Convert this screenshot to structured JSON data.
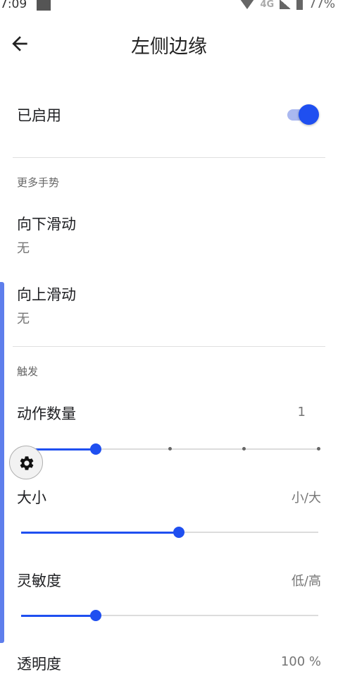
{
  "status": {
    "time": "7:09",
    "network": "4G",
    "battery": "77%"
  },
  "appbar": {
    "title": "左侧边缘",
    "back_icon": "arrow-left-icon"
  },
  "enabled": {
    "label": "已启用",
    "on": true
  },
  "sections": {
    "more_gestures": "更多手势",
    "trigger": "触发"
  },
  "swipe_down": {
    "label": "向下滑动",
    "value": "无"
  },
  "swipe_up": {
    "label": "向上滑动",
    "value": "无"
  },
  "action_count": {
    "label": "动作数量",
    "value": "1",
    "level": 0.25,
    "ticks": 5
  },
  "size": {
    "label": "大小",
    "value": "小/大",
    "level": 0.53
  },
  "sensitivity": {
    "label": "灵敏度",
    "value": "低/高",
    "level": 0.25
  },
  "opacity": {
    "label": "透明度",
    "value": "100 %"
  },
  "colors": {
    "accent": "#1f4ff0",
    "edge_bar": "#5e7eec"
  },
  "fab": {
    "icon": "gear-icon"
  }
}
